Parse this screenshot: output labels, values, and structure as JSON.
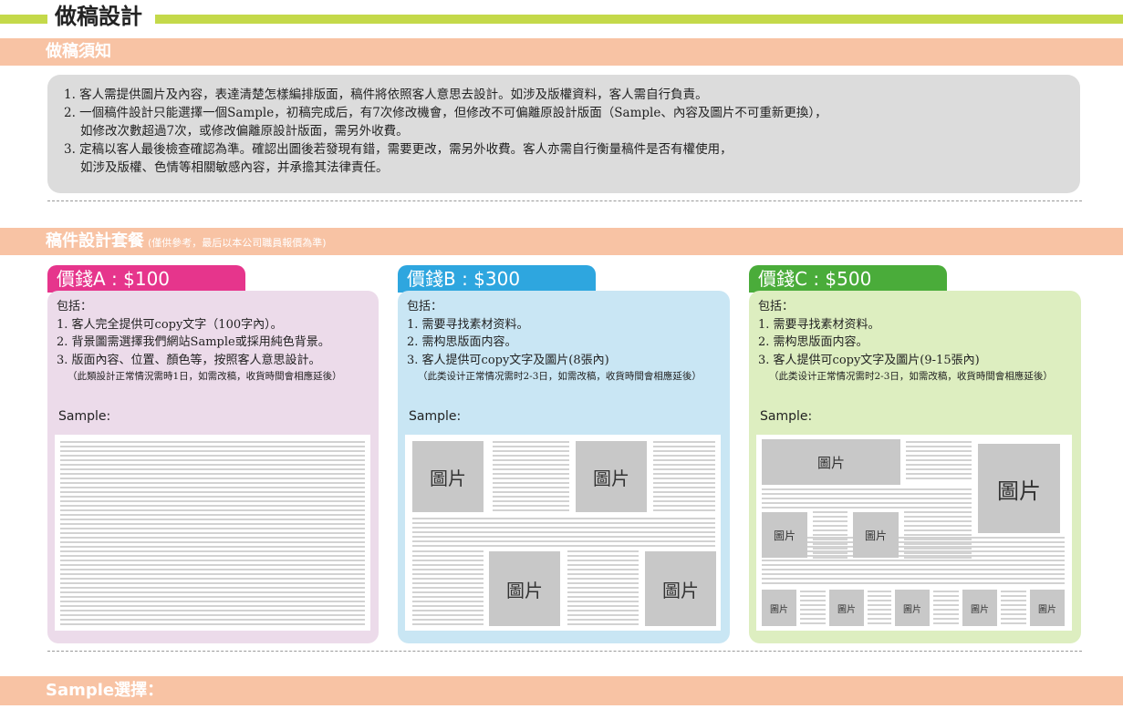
{
  "page_title": "做稿設計",
  "section_notice": {
    "title": "做稿須知",
    "items": [
      [
        "1. 客人需提供圖片及內容，表達清楚怎樣編排版面，稿件將依照客人意思去設計。如涉及版權資料，客人需自行負責。"
      ],
      [
        "2. 一個稿件設計只能選擇一個Sample，初稿完成后，有7次修改機會，但修改不可偏離原設計版面（Sample、內容及圖片不可重新更換），",
        "如修改次數超過7次，或修改偏離原設計版面，需另外收費。"
      ],
      [
        "3. 定稿以客人最後檢查確認為準。確認出圖後若發現有錯，需要更改，需另外收費。客人亦需自行衡量稿件是否有權使用，",
        "如涉及版權、色情等相關敏感內容，并承擔其法律責任。"
      ]
    ]
  },
  "section_packages": {
    "title": "稿件設計套餐",
    "subtitle": "(僅供參考，最后以本公司職員報價為準)"
  },
  "packages": [
    {
      "tab": "價錢A : $100",
      "includes": "包括：",
      "lines": [
        "1. 客人完全提供可copy文字（100字內）。",
        "2. 背景圖需選擇我們網站Sample或採用純色背景。",
        "3. 版面內容、位置、顏色等，按照客人意思設計。"
      ],
      "note": "（此類設計正常情況需時1日，如需改稿，收貨時間會相應延後）",
      "sample_label": "Sample:",
      "colors": {
        "tab": "#e6358c",
        "panel": "#ecdbea"
      }
    },
    {
      "tab": "價錢B : $300",
      "includes": "包括：",
      "lines": [
        "1. 需要寻找素材资料。",
        "2. 需构思版面内容。",
        "3. 客人提供可copy文字及圖片(8張內)"
      ],
      "note": "（此类设计正常情况需时2-3日，如需改稿，收貨時間會相應延後）",
      "sample_label": "Sample:",
      "image_label": "圖片",
      "colors": {
        "tab": "#2ea6df",
        "panel": "#c9e6f4"
      }
    },
    {
      "tab": "價錢C : $500",
      "includes": "包括：",
      "lines": [
        "1. 需要寻找素材资料。",
        "2. 需构思版面内容。",
        "3. 客人提供可copy文字及圖片(9-15張內)"
      ],
      "note": "（此类设计正常情况需时2-3日，如需改稿，收貨時間會相應延後）",
      "sample_label": "Sample:",
      "image_label": "圖片",
      "colors": {
        "tab": "#4aac3a",
        "panel": "#ddeec0"
      }
    }
  ],
  "section_sample": {
    "title": "Sample選擇："
  },
  "colors": {
    "band": "#f8c3a4",
    "title_line": "#c4d94a",
    "notice_box": "#dcdcdc",
    "placeholder": "#c8c8c8"
  }
}
